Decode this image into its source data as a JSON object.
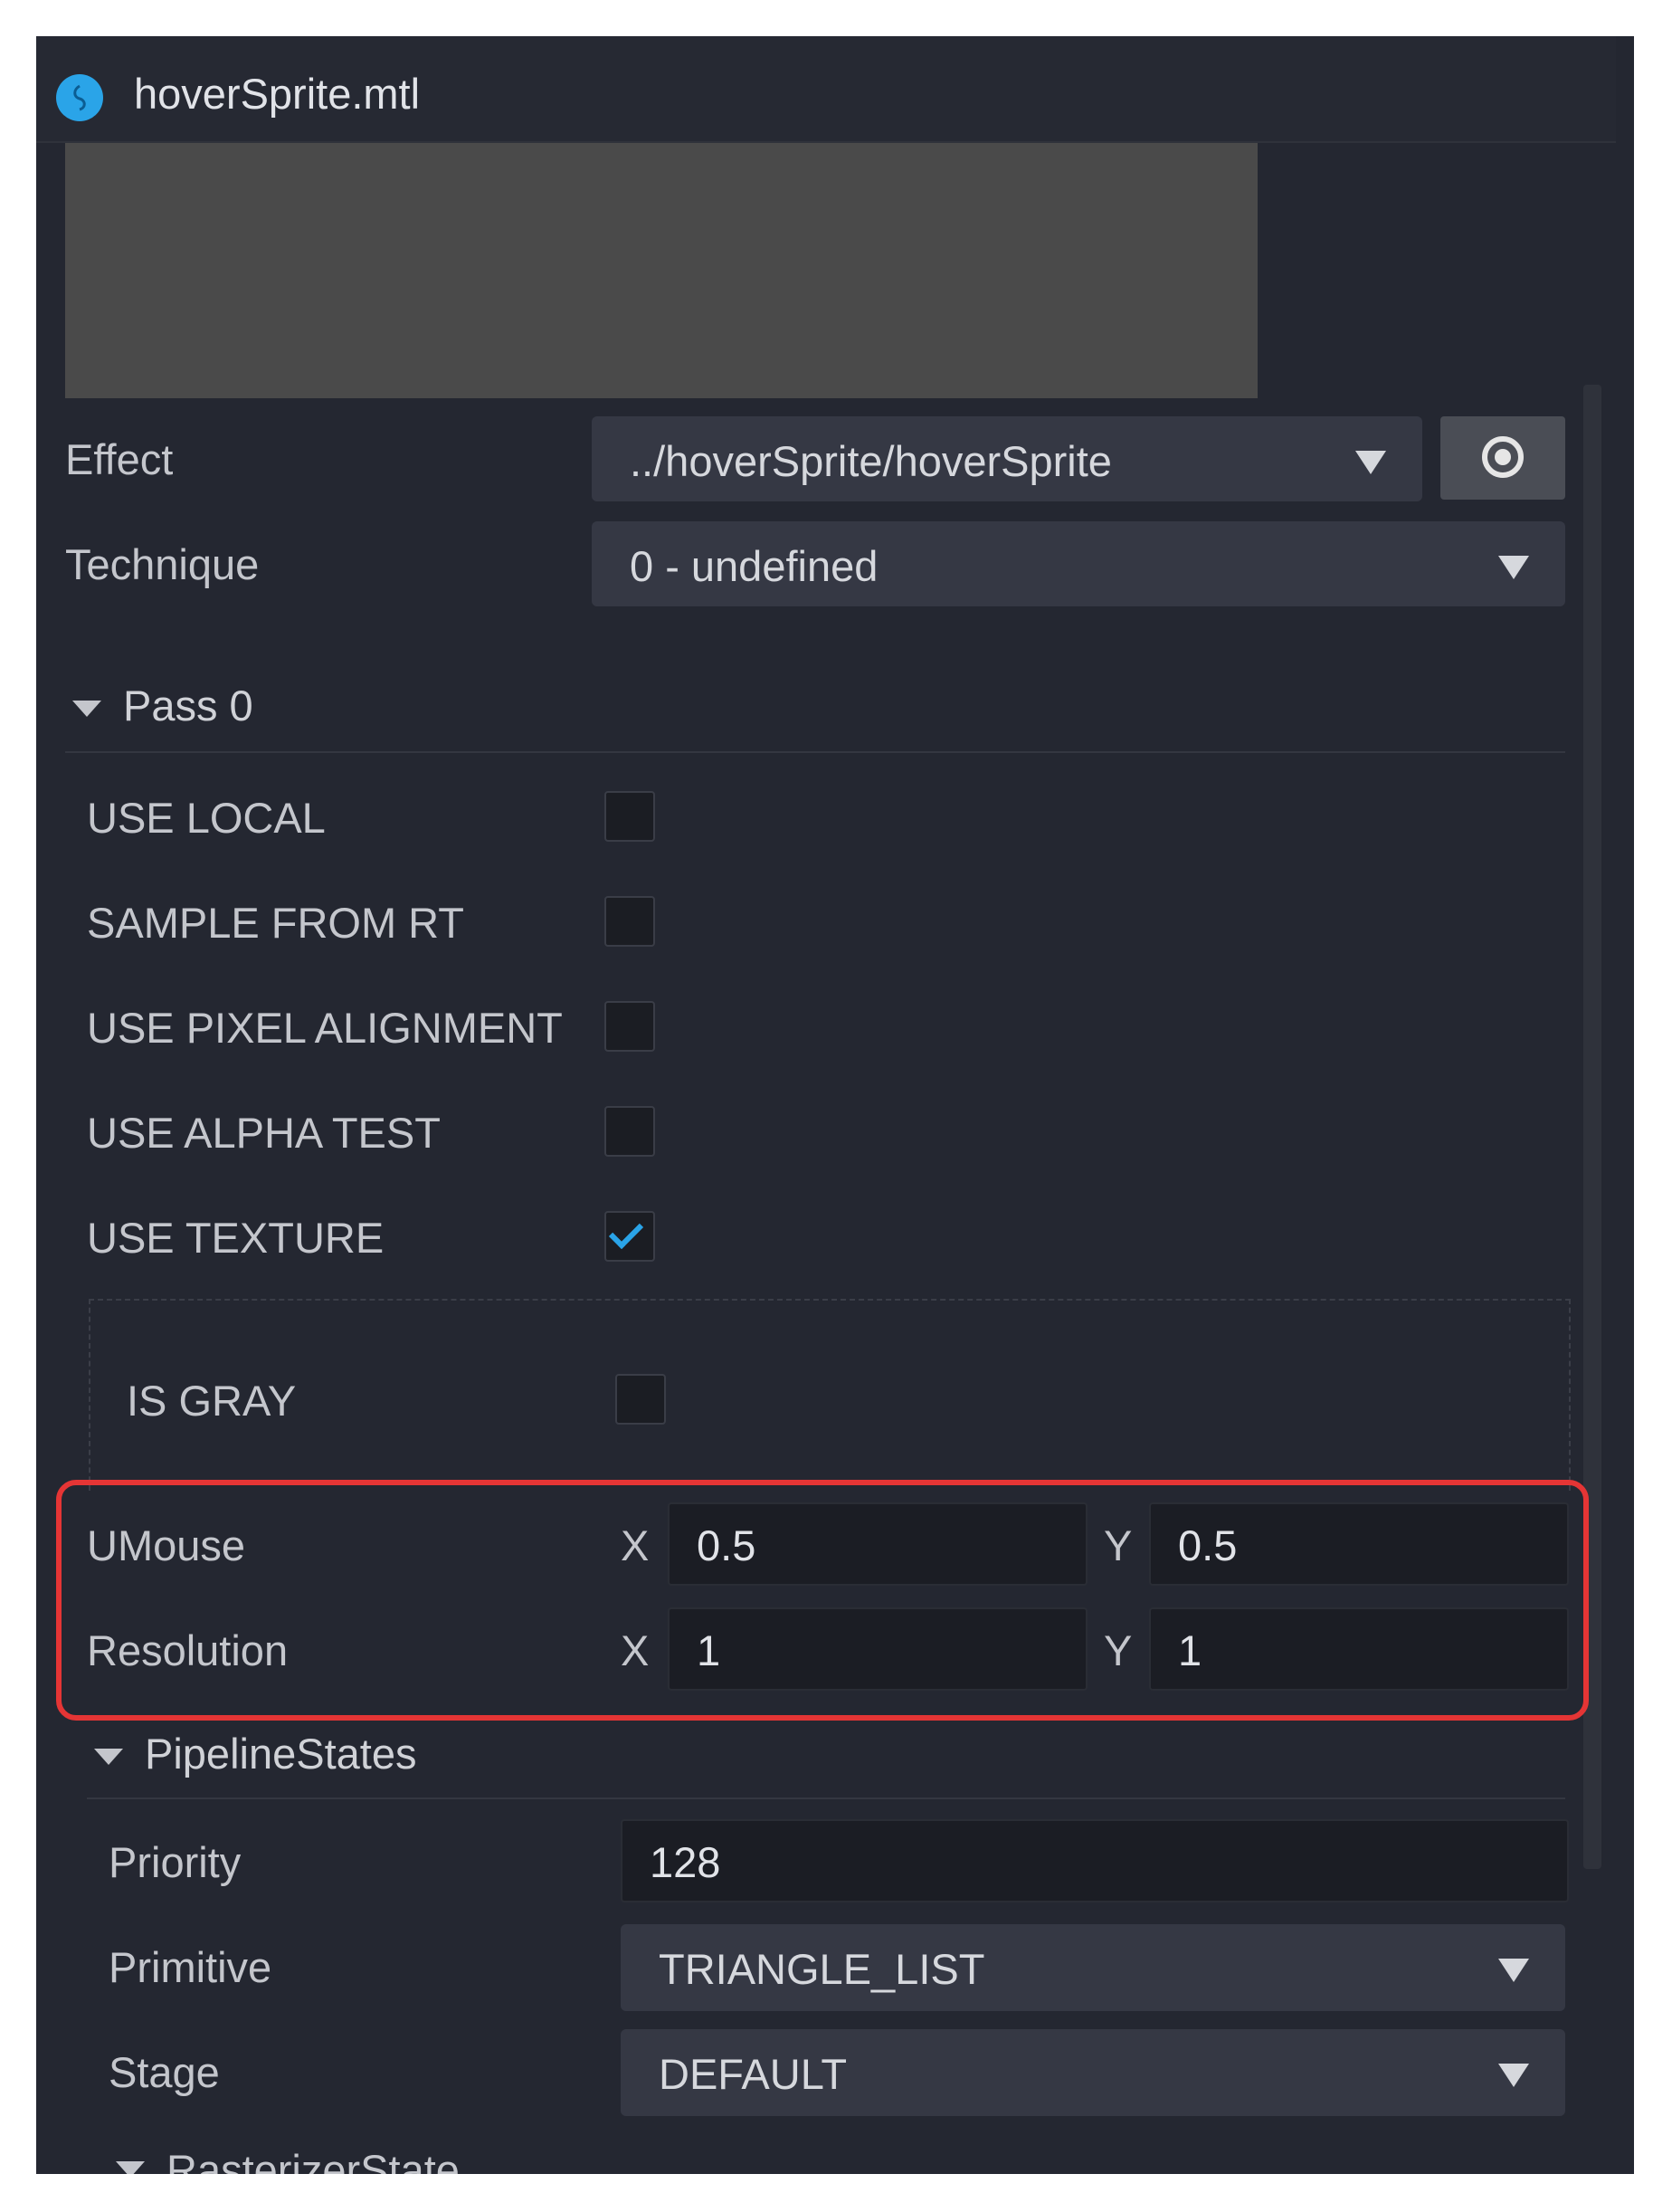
{
  "header": {
    "title": "hoverSprite.mtl",
    "icon": "asset-file-icon"
  },
  "effect": {
    "label": "Effect",
    "value": "../hoverSprite/hoverSprite"
  },
  "technique": {
    "label": "Technique",
    "value": "0 - undefined"
  },
  "pass": {
    "title": "Pass 0",
    "defines": [
      {
        "label": "USE LOCAL",
        "checked": false
      },
      {
        "label": "SAMPLE FROM RT",
        "checked": false
      },
      {
        "label": "USE PIXEL ALIGNMENT",
        "checked": false
      },
      {
        "label": "USE ALPHA TEST",
        "checked": false
      },
      {
        "label": "USE TEXTURE",
        "checked": true
      }
    ],
    "is_gray": {
      "label": "IS GRAY",
      "checked": false
    },
    "umouse": {
      "label": "UMouse",
      "x_label": "X",
      "x": "0.5",
      "y_label": "Y",
      "y": "0.5"
    },
    "resolution": {
      "label": "Resolution",
      "x_label": "X",
      "x": "1",
      "y_label": "Y",
      "y": "1"
    }
  },
  "pipeline": {
    "title": "PipelineStates",
    "priority": {
      "label": "Priority",
      "value": "128"
    },
    "primitive": {
      "label": "Primitive",
      "value": "TRIANGLE_LIST"
    },
    "stage": {
      "label": "Stage",
      "value": "DEFAULT"
    },
    "next_section": "RasterizerState"
  },
  "colors": {
    "accent": "#2aa4e8",
    "highlight": "#e53535",
    "panel": "#242731"
  }
}
